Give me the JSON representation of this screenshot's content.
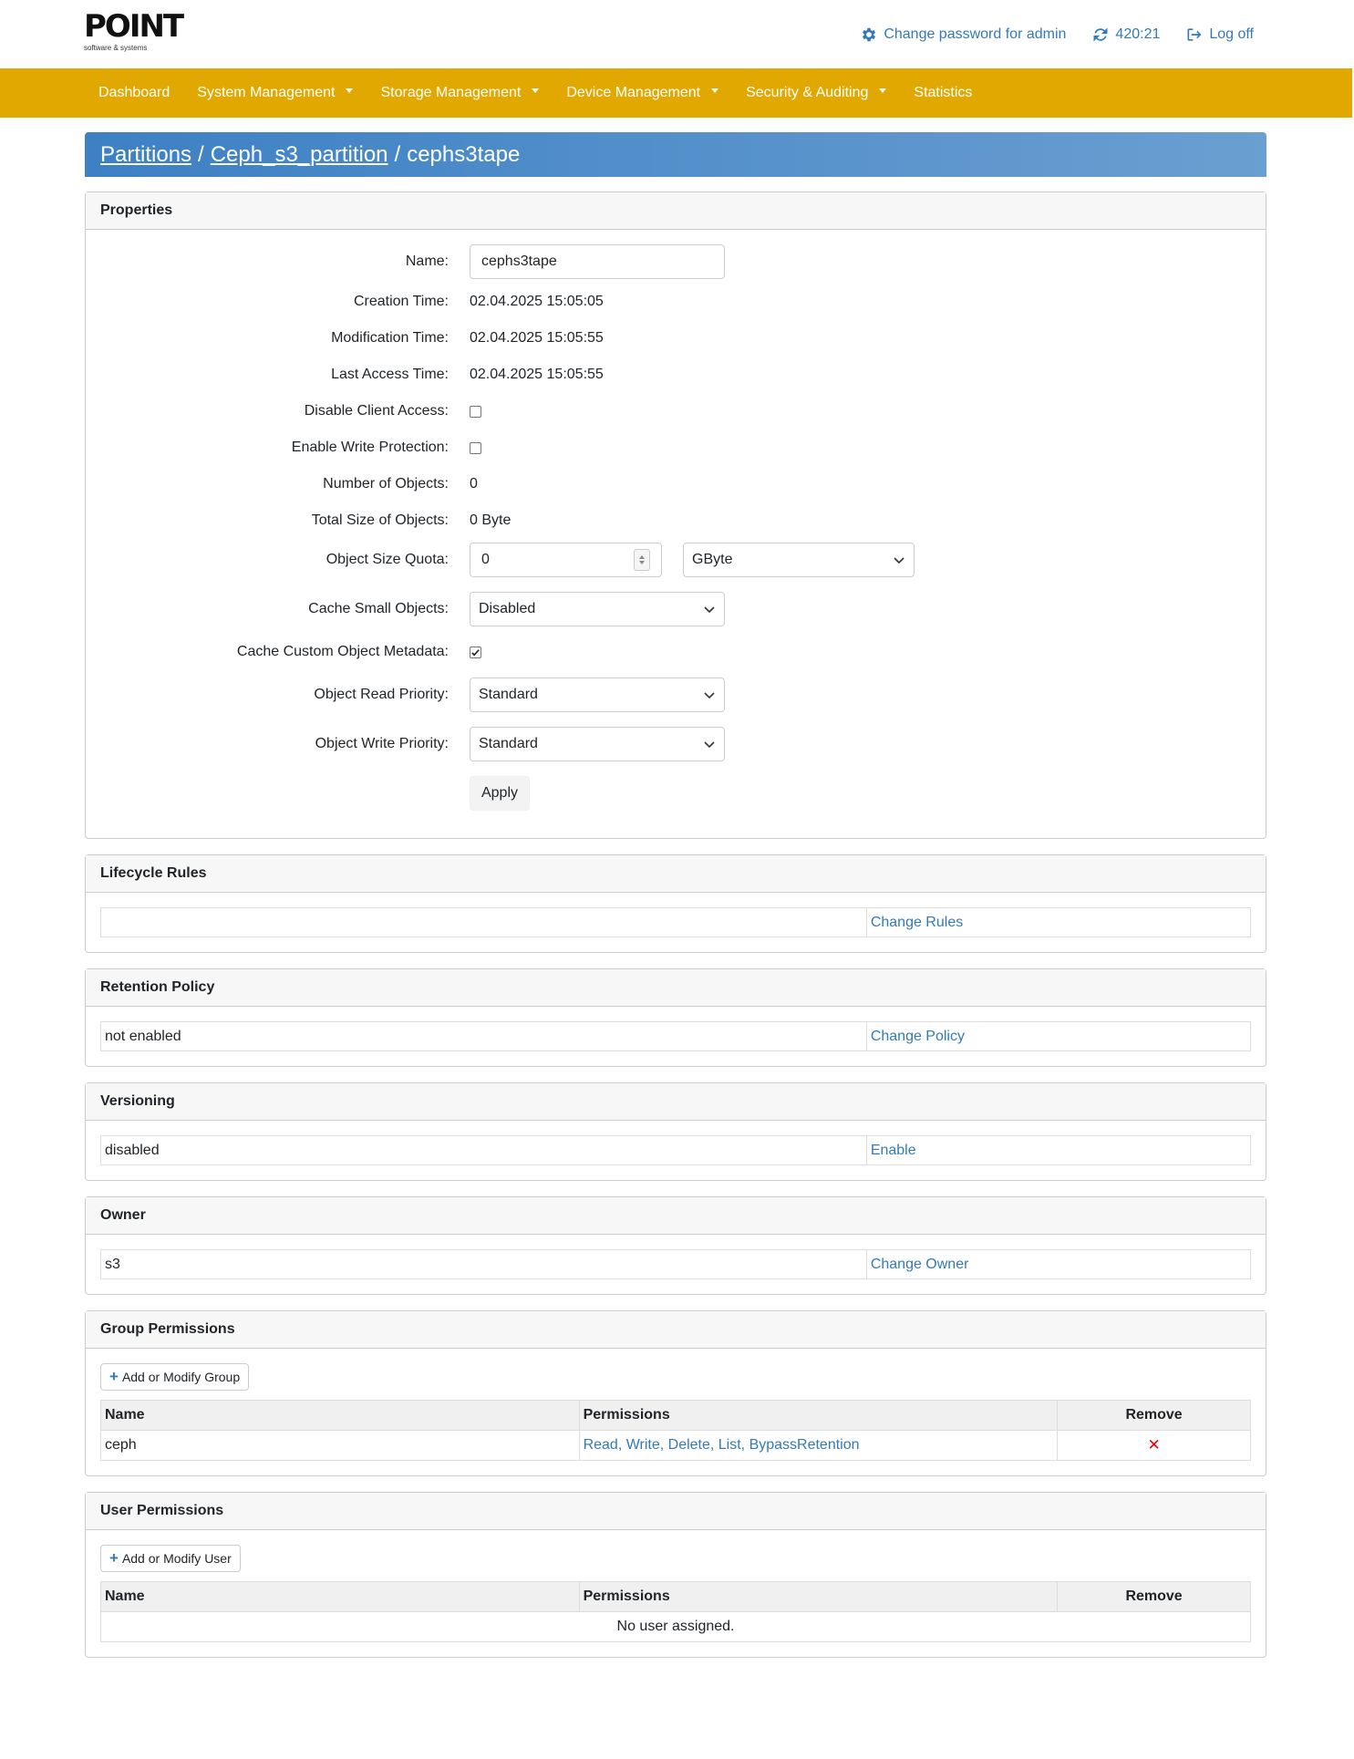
{
  "header": {
    "logo_text": "POINT",
    "logo_subtitle": "software & systems",
    "change_password_label": "Change password for admin",
    "session_timer": "420:21",
    "logoff_label": "Log off"
  },
  "nav": {
    "items": [
      {
        "label": "Dashboard"
      },
      {
        "label": "System Management"
      },
      {
        "label": "Storage Management"
      },
      {
        "label": "Device Management"
      },
      {
        "label": "Security & Auditing"
      },
      {
        "label": "Statistics"
      }
    ]
  },
  "breadcrumb": {
    "crumb1": "Partitions",
    "crumb2": "Ceph_s3_partition",
    "current": "cephs3tape",
    "separator": "/"
  },
  "properties": {
    "title": "Properties",
    "name_label": "Name:",
    "name_value": "cephs3tape",
    "creation_label": "Creation Time:",
    "creation_value": "02.04.2025 15:05:05",
    "modification_label": "Modification Time:",
    "modification_value": "02.04.2025 15:05:55",
    "last_access_label": "Last Access Time:",
    "last_access_value": "02.04.2025 15:05:55",
    "disable_client_label": "Disable Client Access:",
    "disable_client_checked": false,
    "write_protection_label": "Enable Write Protection:",
    "write_protection_checked": false,
    "num_objects_label": "Number of Objects:",
    "num_objects_value": "0",
    "total_size_label": "Total Size of Objects:",
    "total_size_value": "0 Byte",
    "quota_label": "Object Size Quota:",
    "quota_value": "0",
    "quota_unit": "GByte",
    "cache_small_label": "Cache Small Objects:",
    "cache_small_value": "Disabled",
    "cache_meta_label": "Cache Custom Object Metadata:",
    "cache_meta_checked": true,
    "read_priority_label": "Object Read Priority:",
    "read_priority_value": "Standard",
    "write_priority_label": "Object Write Priority:",
    "write_priority_value": "Standard",
    "apply_label": "Apply"
  },
  "lifecycle": {
    "title": "Lifecycle Rules",
    "value": "",
    "action": "Change Rules"
  },
  "retention": {
    "title": "Retention Policy",
    "value": "not enabled",
    "action": "Change Policy"
  },
  "versioning": {
    "title": "Versioning",
    "value": "disabled",
    "action": "Enable"
  },
  "owner": {
    "title": "Owner",
    "value": "s3",
    "action": "Change Owner"
  },
  "group_permissions": {
    "title": "Group Permissions",
    "add_button": "Add or Modify Group",
    "columns": {
      "name": "Name",
      "permissions": "Permissions",
      "remove": "Remove"
    },
    "rows": [
      {
        "name": "ceph",
        "permissions": "Read, Write, Delete, List, BypassRetention",
        "remove": "✕"
      }
    ]
  },
  "user_permissions": {
    "title": "User Permissions",
    "add_button": "Add or Modify User",
    "columns": {
      "name": "Name",
      "permissions": "Permissions",
      "remove": "Remove"
    },
    "empty_text": "No user assigned."
  },
  "colors": {
    "nav_bg": "#e0a800",
    "link": "#337ab7",
    "breadcrumb_start": "#3d80c4",
    "breadcrumb_end": "#6a9fd1",
    "remove": "#e00000"
  },
  "icons": [
    "gear-icon",
    "refresh-icon",
    "logoff-icon",
    "plus-icon",
    "remove-icon",
    "chevron-down-icon"
  ]
}
